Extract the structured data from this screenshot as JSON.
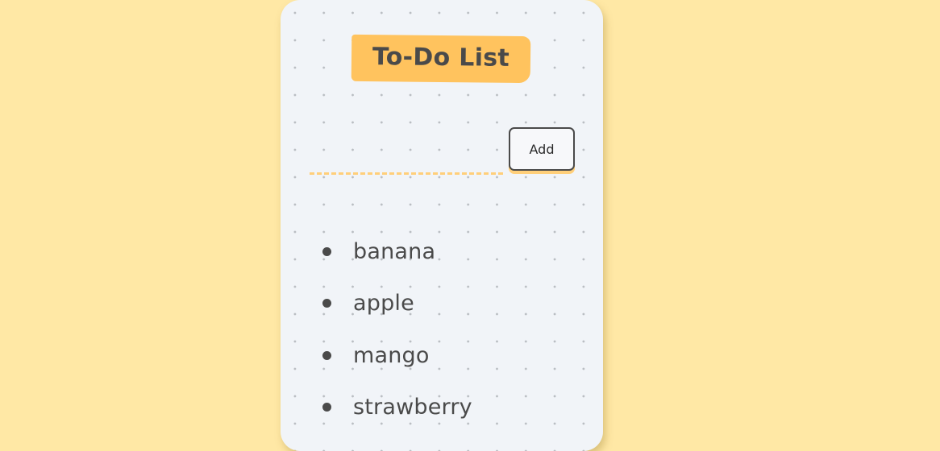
{
  "app": {
    "title": "To-Do List"
  },
  "input": {
    "value": "",
    "placeholder": ""
  },
  "add_button": {
    "label": "Add"
  },
  "tasks": [
    {
      "text": "banana"
    },
    {
      "text": "apple"
    },
    {
      "text": "mango"
    },
    {
      "text": "strawberry"
    }
  ],
  "colors": {
    "page_background": "#ffe8a5",
    "card_background": "#f1f4f8",
    "accent": "#ffc35e",
    "text": "#4a4a4a"
  }
}
